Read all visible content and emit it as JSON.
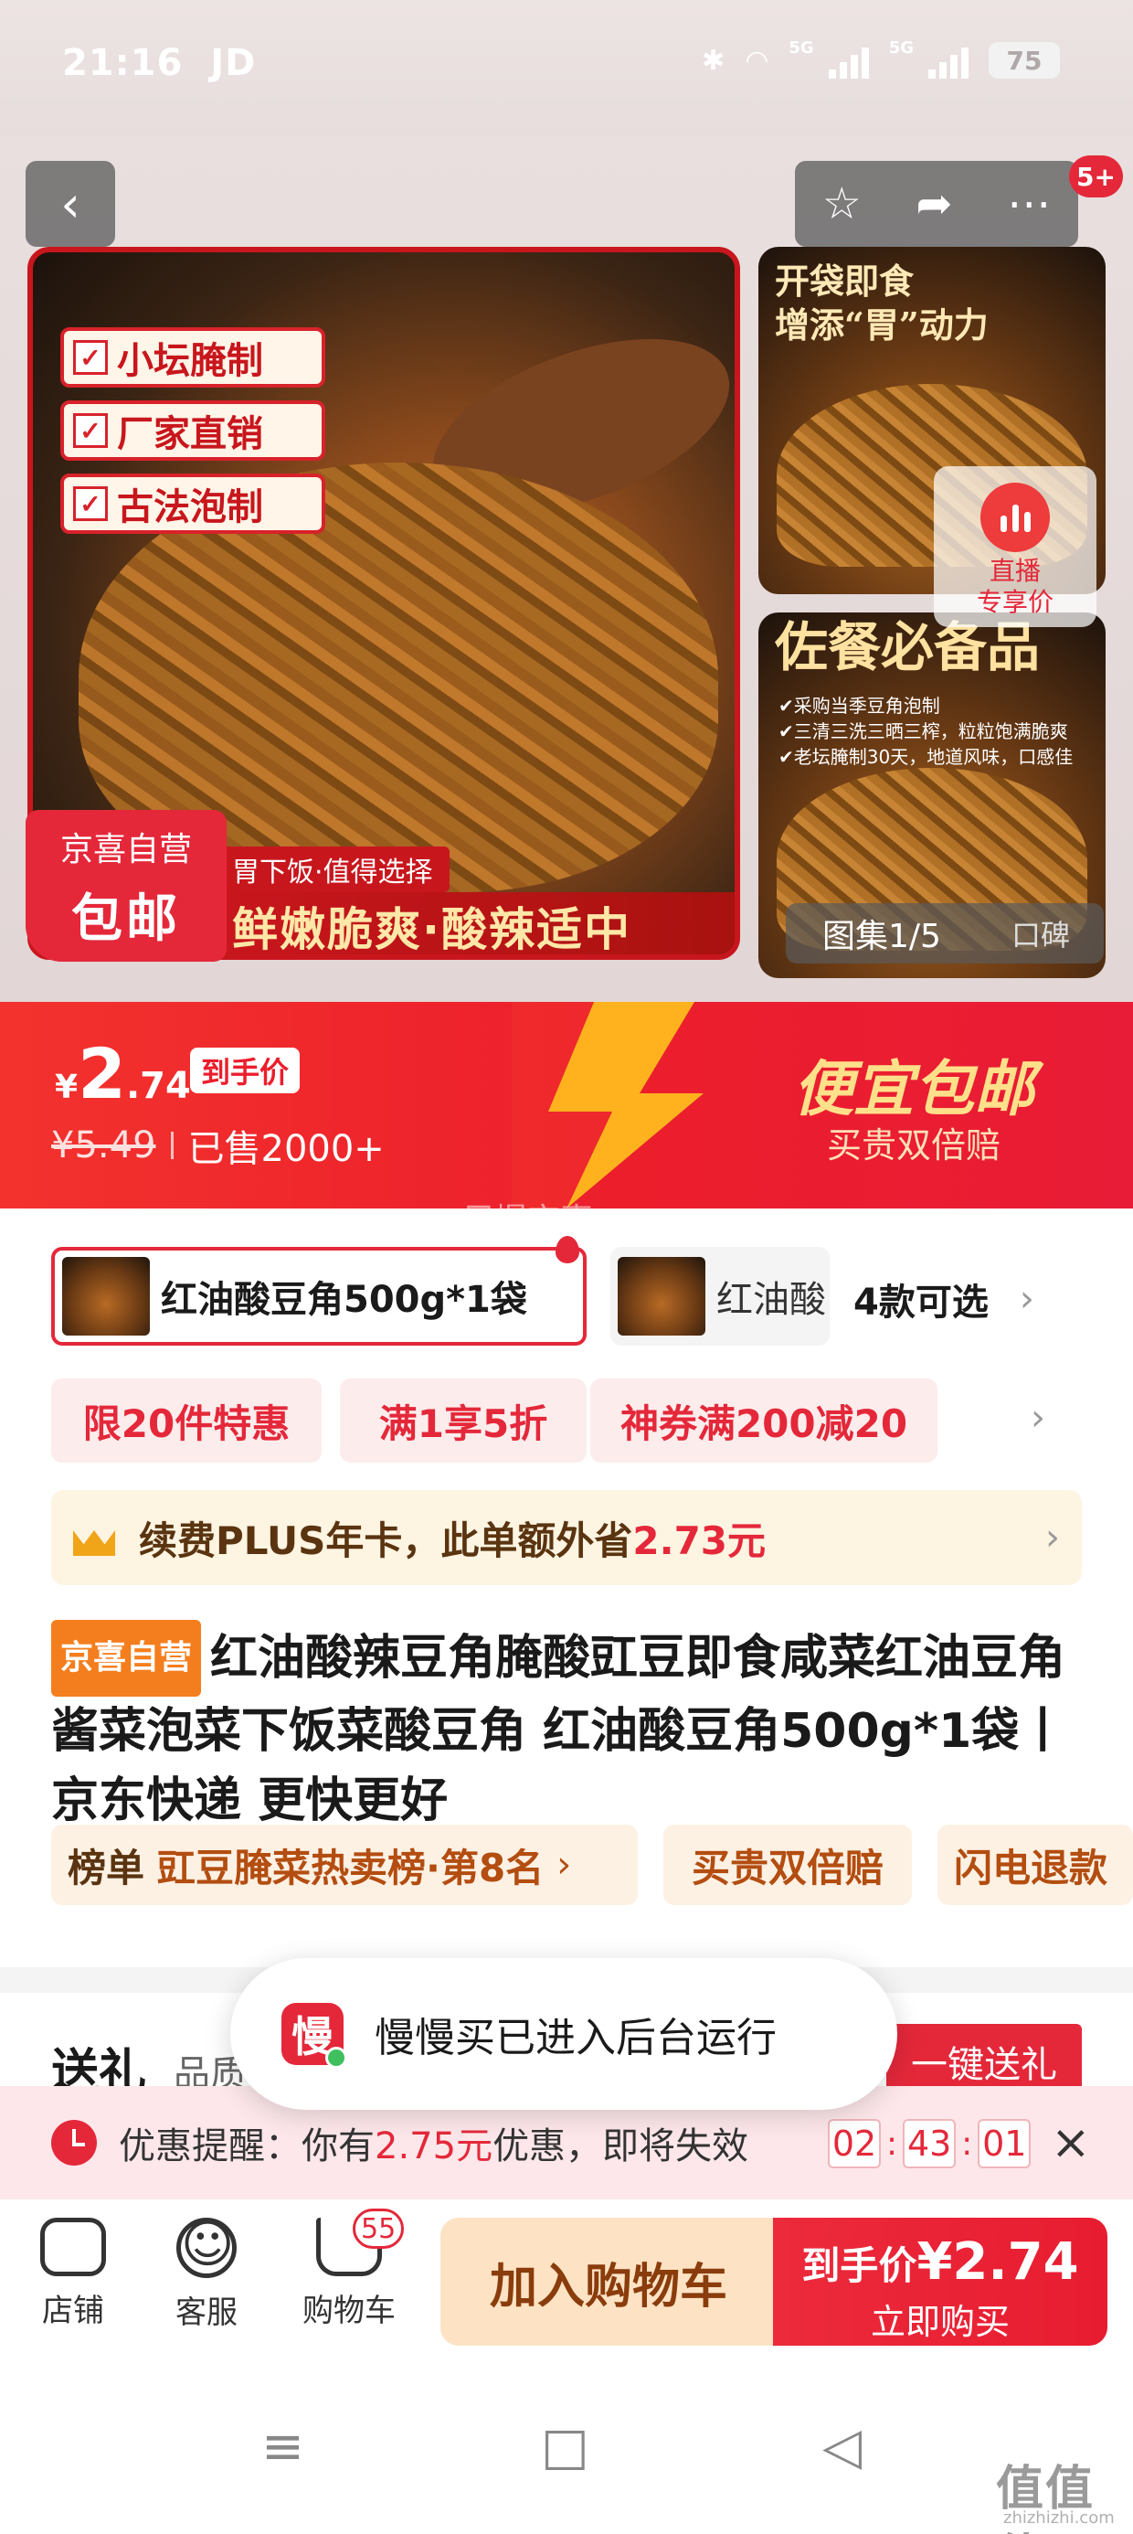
{
  "status_bar": {
    "time": "21:16",
    "carrier": "JD",
    "net1": "5G",
    "net2": "5G",
    "battery": "75"
  },
  "gallery": {
    "notification_badge": "5+",
    "main_tags": [
      "小坛腌制",
      "厂家直销",
      "古法泡制"
    ],
    "main_subline": "胃下饭·值得选择",
    "main_slogan": "鲜嫩脆爽·酸辣适中",
    "promo_line1": "京喜自营",
    "promo_line2": "包邮",
    "side1_title_l1": "开袋即食",
    "side1_title_l2": "增添“胃”动力",
    "side2_title": "佐餐必备品",
    "side2_bullets": [
      "✔采购当季豆角泡制",
      "✔三清三洗三晒三榨，粒粒饱满脆爽",
      "✔老坛腌制30天，地道风味，口感佳"
    ],
    "live_line1": "直播",
    "live_line2": "专享价",
    "counter": "图集1/5",
    "counter_tab": "口碑"
  },
  "price": {
    "currency": "¥",
    "integer": "2",
    "decimal": ".74",
    "tag": "到手价",
    "original": "¥5.49",
    "sold": "已售2000+",
    "slogan": "便宜包邮",
    "slogan_sub": "买贵双倍赔",
    "watermark": "尸爆京喜"
  },
  "sku": {
    "selected": "红油酸豆角500g*1袋",
    "second": "红油酸",
    "more": "4款可选"
  },
  "coupons": [
    "限20件特惠",
    "满1享5折",
    "神券满200减20"
  ],
  "plus": {
    "text": "续费PLUS年卡，此单额外省",
    "amount": "2.73元"
  },
  "title": {
    "brand": "京喜自营",
    "text": "红油酸辣豆角腌酸豇豆即食咸菜红油豆角酱菜泡菜下饭菜酸豆角 红油酸豆角500g*1袋丨京东快递 更快更好"
  },
  "tags": {
    "rank_label": "榜单",
    "rank_text": "豇豆腌菜热卖榜·第8名",
    "guarantee": "买贵双倍赔",
    "refund": "闪电退款"
  },
  "gift": {
    "label": "送礼",
    "sub": "品质",
    "button": "一键送礼"
  },
  "toast": {
    "icon_char": "慢",
    "text": "慢慢买已进入后台运行"
  },
  "reminder": {
    "prefix": "优惠提醒：你有",
    "amount": "2.75元",
    "suffix": "优惠，即将失效",
    "hh": "02",
    "mm": "43",
    "ss": "01"
  },
  "bottom": {
    "shop": "店铺",
    "service": "客服",
    "cart": "购物车",
    "cart_count": "55",
    "add_cart": "加入购物车",
    "buy_prefix": "到手价",
    "buy_price": "¥2.74",
    "buy_now": "立即购买"
  },
  "footer": {
    "site_mark": "值值值",
    "site_url": "zhizhizhi.com"
  },
  "colors": {
    "accent_red": "#e4283a",
    "plus_bg": "#fdf4e2",
    "add_cart_bg": "#fde3c4"
  }
}
